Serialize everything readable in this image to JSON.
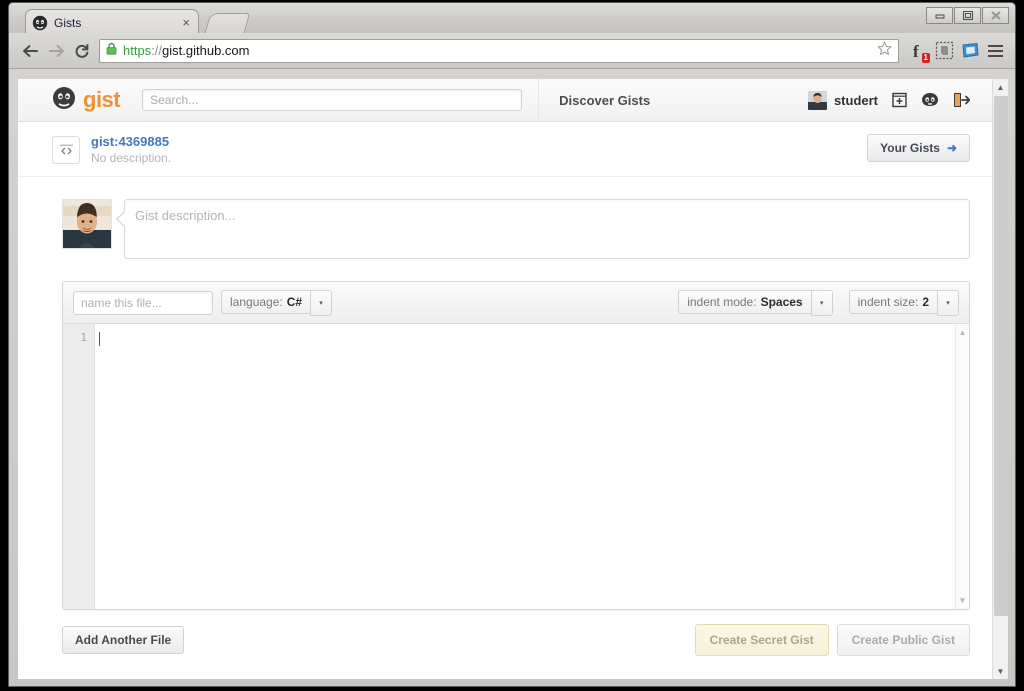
{
  "browser": {
    "tab": {
      "title": "Gists",
      "favicon": "octocat-icon",
      "close": "×"
    },
    "nav": {
      "back": "←",
      "forward": "→",
      "reload": "↻"
    },
    "url": {
      "scheme": "https",
      "separator": "://",
      "host": "gist.github.com",
      "lock": "padlock-icon"
    },
    "bookmark_star": "☆",
    "extensions": [
      {
        "name": "facebook-extension-icon",
        "badge": "1"
      },
      {
        "name": "evernote-extension-icon",
        "badge": ""
      },
      {
        "name": "blue-app-extension-icon",
        "badge": ""
      }
    ],
    "window_controls": {
      "minimize": "minimize",
      "maximize": "maximize",
      "close": "close"
    }
  },
  "site_header": {
    "brand": "gist",
    "search_placeholder": "Search...",
    "search_value": "",
    "discover_label": "Discover Gists",
    "username": "studert",
    "icons": [
      "new-gist-icon",
      "octocat-icon",
      "sign-out-icon"
    ]
  },
  "gist_meta": {
    "title": "gist:4369885",
    "description": "No description.",
    "your_gists_label": "Your Gists",
    "your_gists_arrow": "➜"
  },
  "description": {
    "placeholder": "Gist description...",
    "value": ""
  },
  "file": {
    "name_placeholder": "name this file...",
    "name_value": "",
    "language_label": "language:",
    "language_value": "C#",
    "indent_mode_label": "indent mode:",
    "indent_mode_value": "Spaces",
    "indent_size_label": "indent size:",
    "indent_size_value": "2",
    "caret": "▾",
    "line_numbers": "1",
    "code_value": ""
  },
  "actions": {
    "add_another_file": "Add Another File",
    "create_secret": "Create Secret Gist",
    "create_public": "Create Public Gist"
  },
  "colors": {
    "brand_orange": "#f0913a",
    "link_blue": "#4078c0",
    "https_green": "#2c9f38",
    "badge_red": "#cf2222",
    "secret_bg": "#f7f4db"
  }
}
